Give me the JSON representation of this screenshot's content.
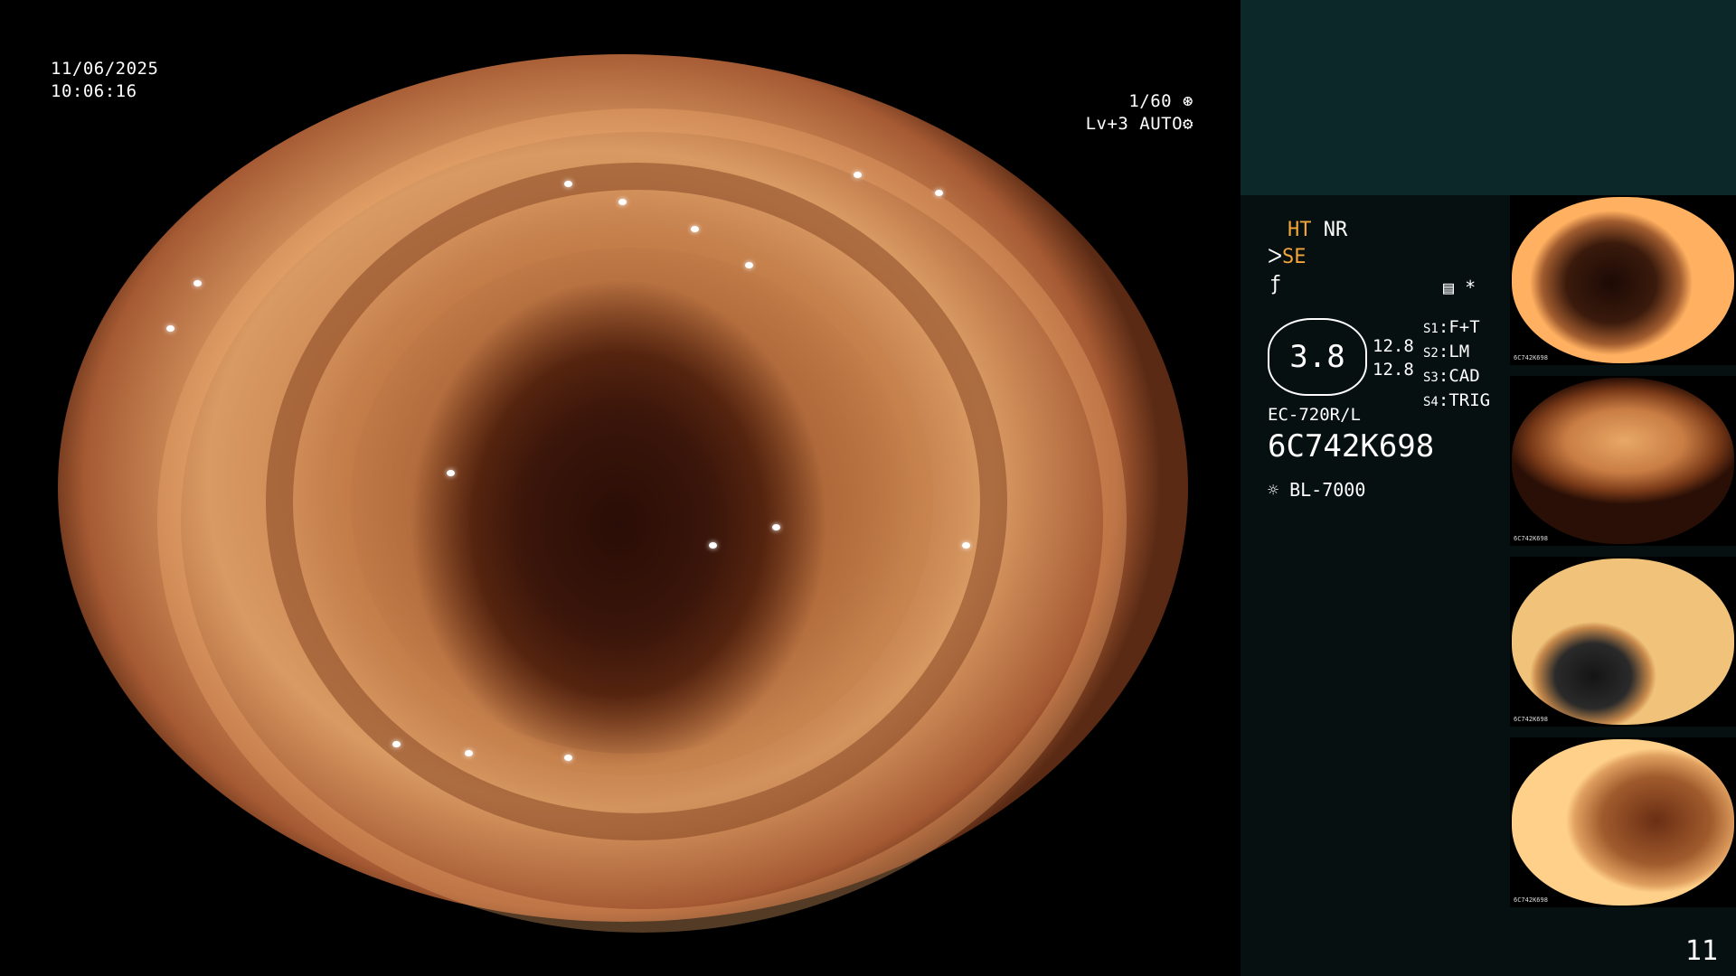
{
  "datetime": {
    "date": "11/06/2025",
    "time": "10:06:16"
  },
  "camera": {
    "shutter": "1/60",
    "level": "Lv+3",
    "mode": "AUTO"
  },
  "modes": {
    "ht": "HT",
    "nr": "NR",
    "se": "SE",
    "s_asterisk": "*"
  },
  "gauge": {
    "value": "3.8",
    "reading_1": "12.8",
    "reading_2": "12.8"
  },
  "switches": [
    {
      "key": "S1",
      "label": "F+T"
    },
    {
      "key": "S2",
      "label": "LM"
    },
    {
      "key": "S3",
      "label": "CAD"
    },
    {
      "key": "S4",
      "label": "TRIG"
    }
  ],
  "scope": {
    "model": "EC-720R/L",
    "serial": "6C742K698",
    "light_source": "BL-7000"
  },
  "thumbnails": [
    {
      "label": "6C742K698"
    },
    {
      "label": "6C742K698"
    },
    {
      "label": "6C742K698"
    },
    {
      "label": "6C742K698"
    }
  ],
  "page_number": "11",
  "colors": {
    "accent_orange": "#f3a53a",
    "panel_top": "#0d2828",
    "panel_bg": "#061010"
  },
  "icons": {
    "shutter": "aperture-icon",
    "auto": "gear-icon",
    "light": "sun-icon",
    "menu": "settings-list-icon"
  }
}
